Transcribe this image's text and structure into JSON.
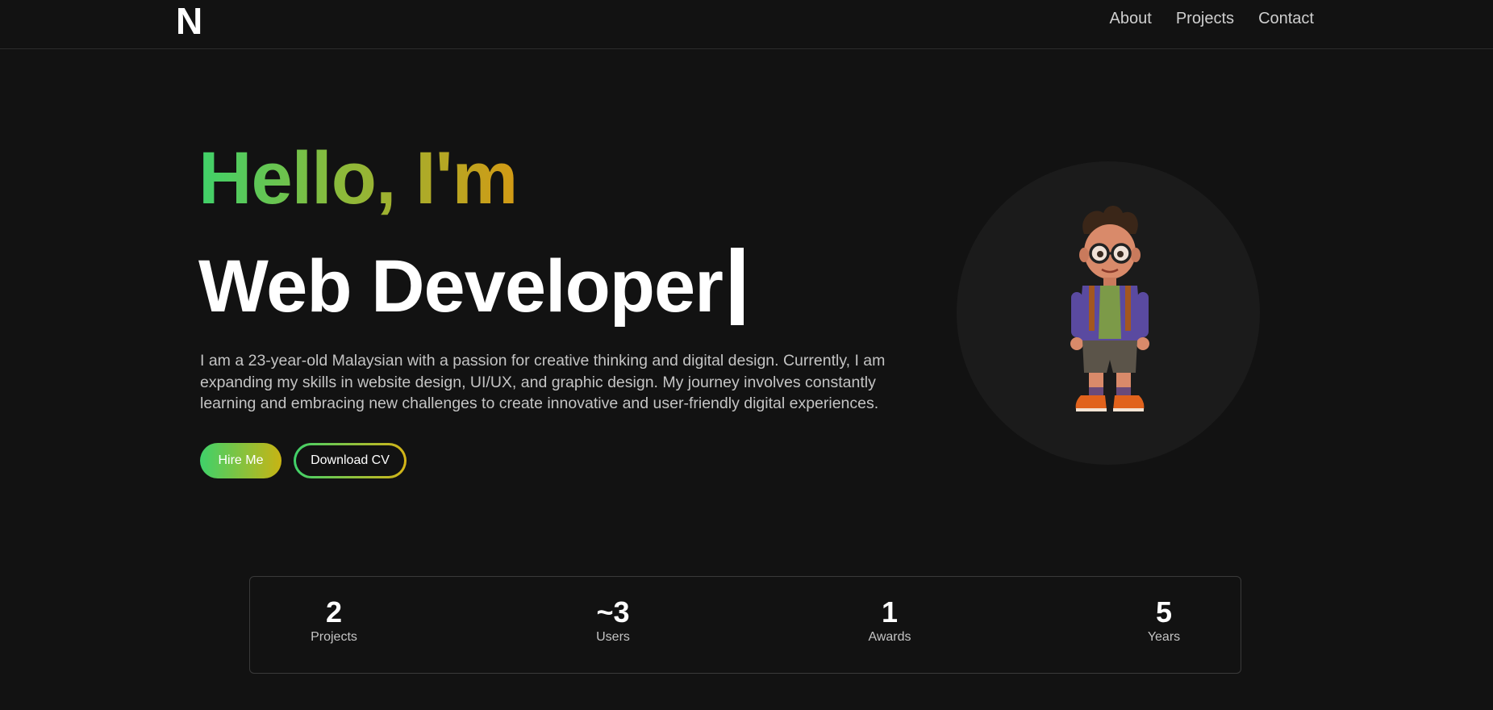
{
  "nav": {
    "logo": "N",
    "links": [
      "About",
      "Projects",
      "Contact"
    ]
  },
  "hero": {
    "greeting": "Hello, I'm",
    "role": "Web Developer",
    "bio": "I am a 23-year-old Malaysian with a passion for creative thinking and digital design. Currently, I am expanding my skills in website design, UI/UX, and graphic design. My journey involves constantly learning and embracing new challenges to create innovative and user-friendly digital experiences.",
    "hire_label": "Hire Me",
    "cv_label": "Download CV"
  },
  "stats": [
    {
      "value": "2",
      "label": "Projects"
    },
    {
      "value": "~3",
      "label": "Users"
    },
    {
      "value": "1",
      "label": "Awards"
    },
    {
      "value": "5",
      "label": "Years"
    }
  ],
  "colors": {
    "background": "#121212",
    "gradient_start": "#3fd16a",
    "gradient_end": "#d39a14"
  }
}
